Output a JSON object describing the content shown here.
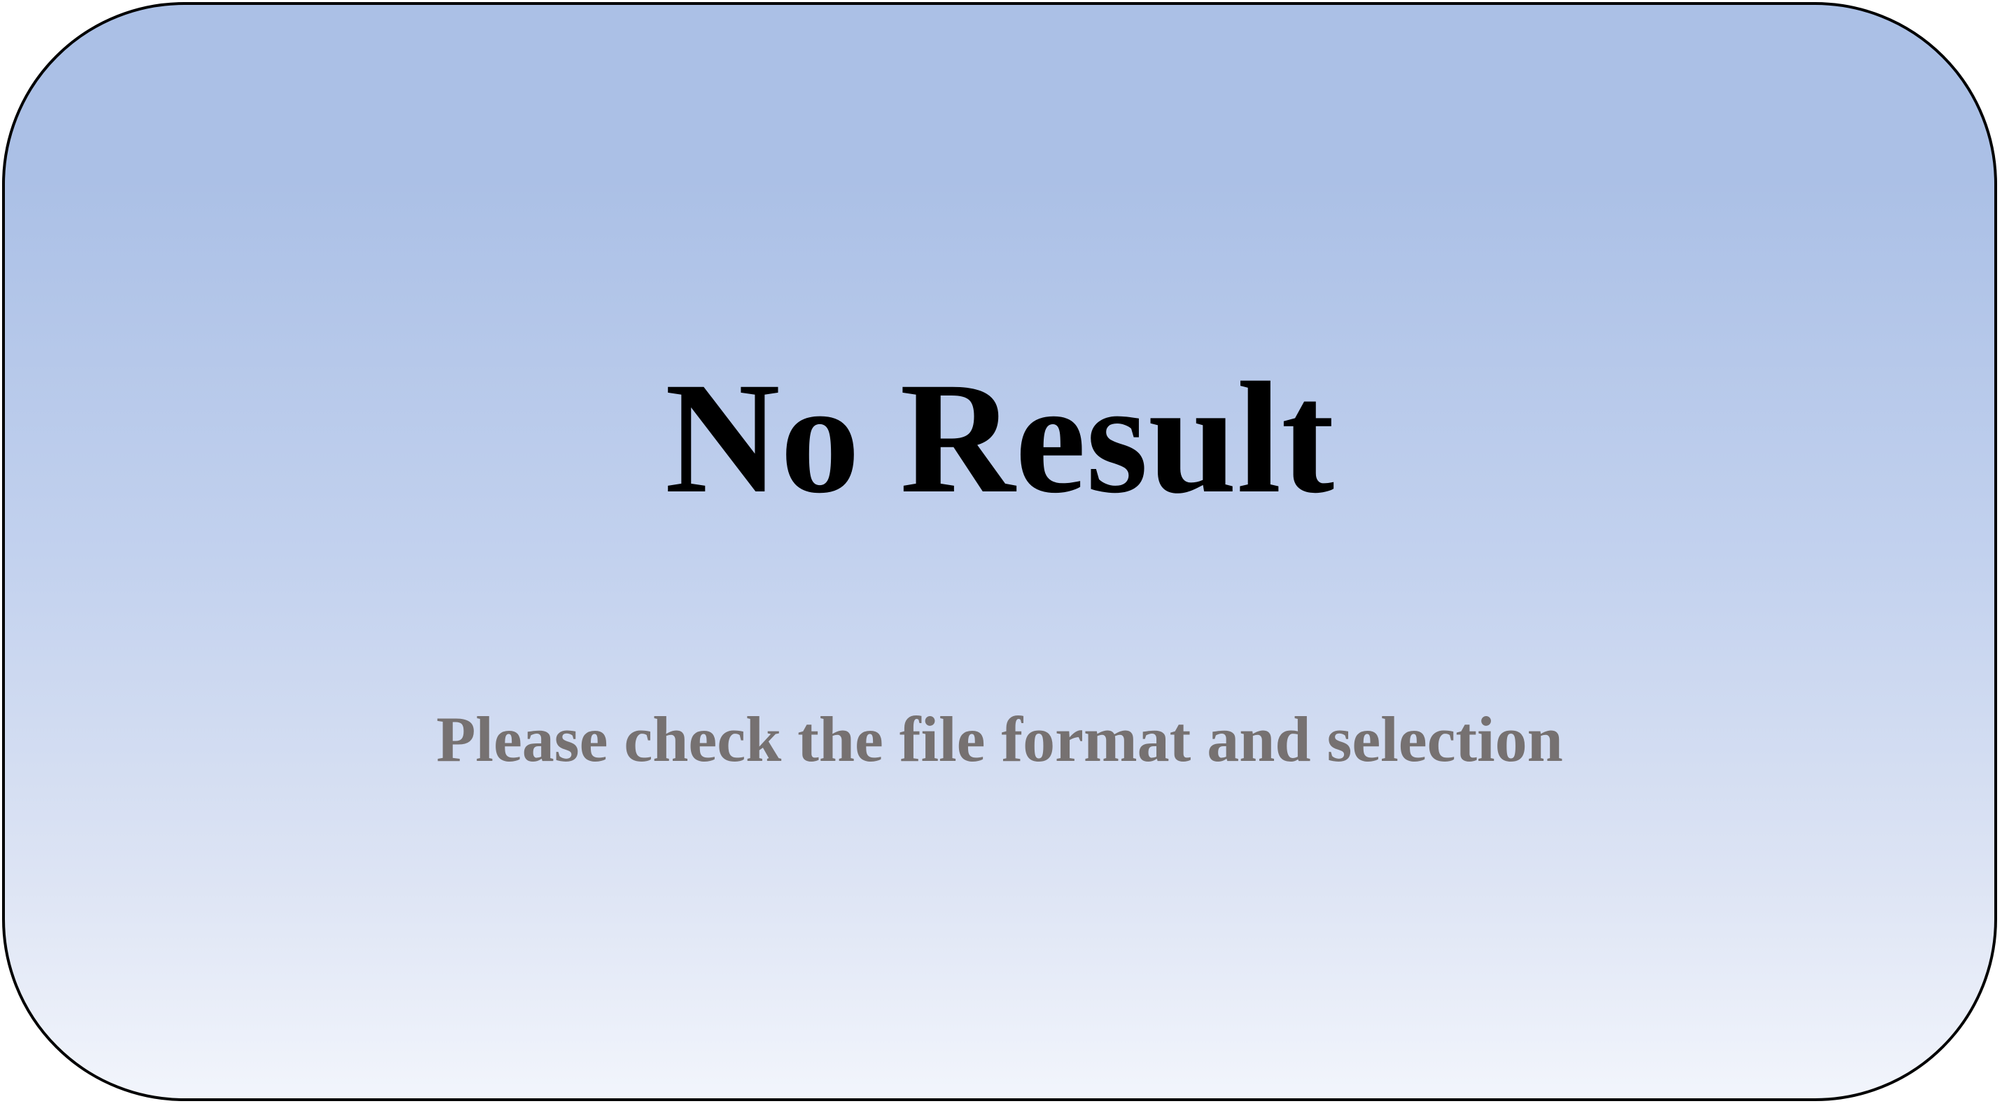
{
  "message": {
    "title": "No Result",
    "subtitle": "Please check the file format and selection"
  },
  "colors": {
    "title": "#000000",
    "subtitle": "#767171",
    "border": "#000000",
    "gradient_top": "#abc0e6",
    "gradient_bottom": "#f2f5fc"
  }
}
